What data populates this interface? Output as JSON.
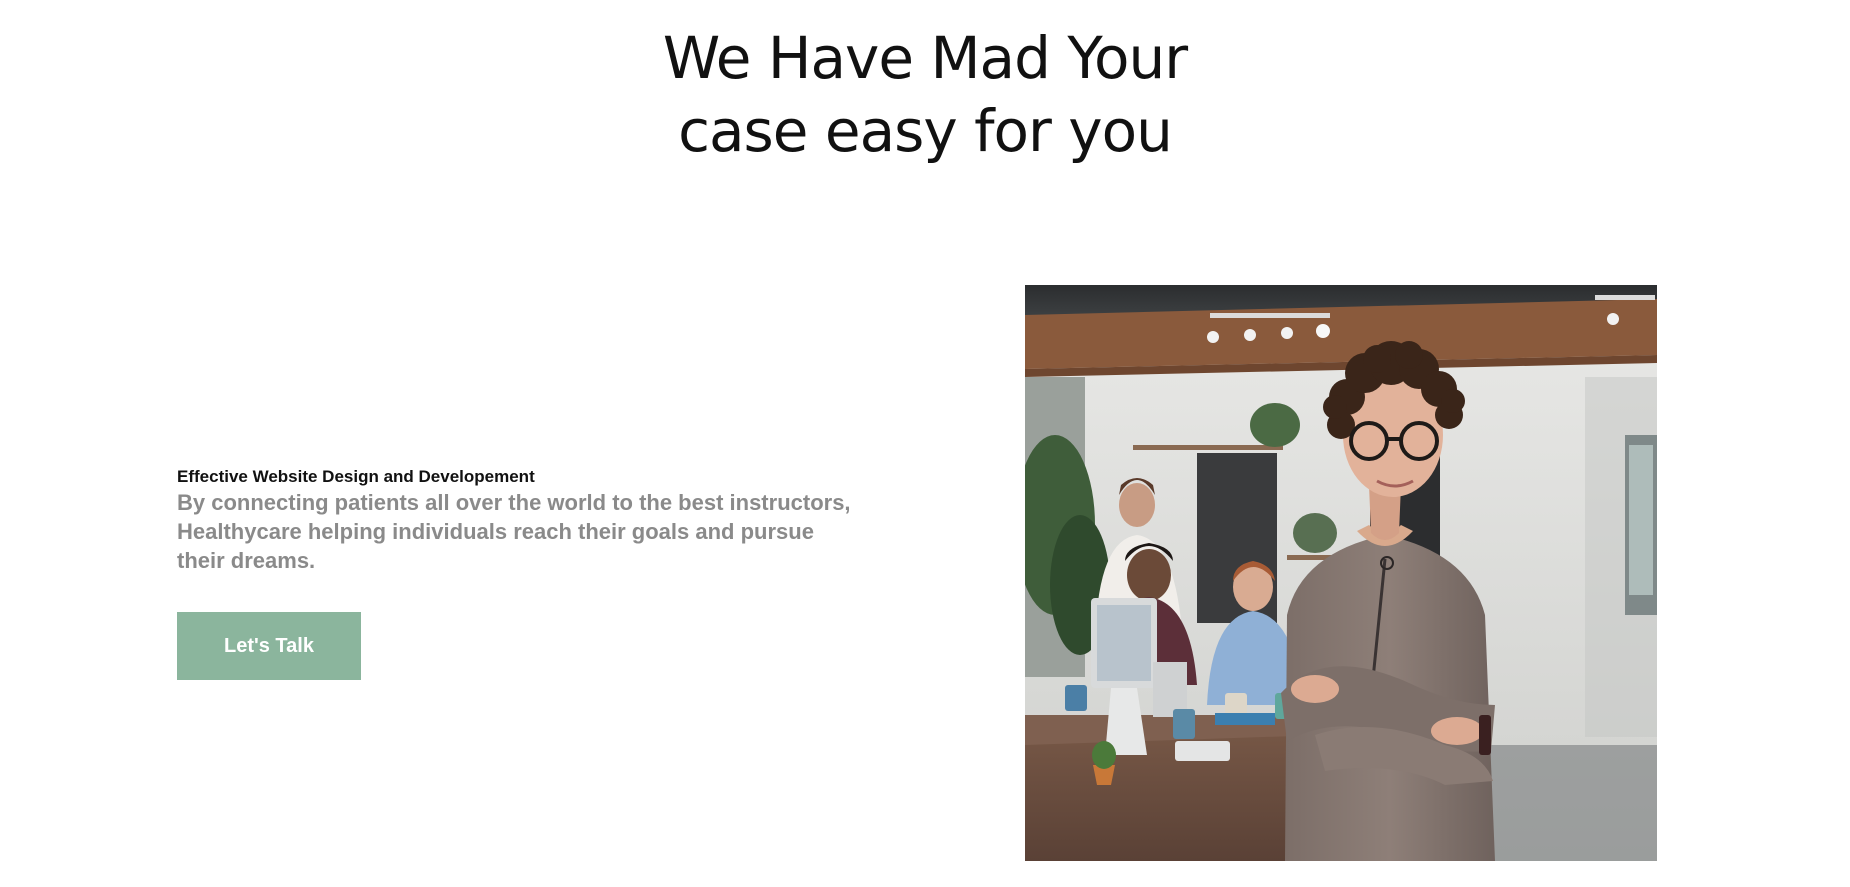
{
  "hero": {
    "title_line1": "We Have Mad Your",
    "title_line2": "case easy for you"
  },
  "intro": {
    "eyebrow": "Effective Website Design and Developement",
    "lead": "By connecting patients all over the world to the best instructors, Healthycare helping individuals reach their goals and pursue their dreams."
  },
  "cta": {
    "label": "Let's Talk"
  },
  "colors": {
    "accent": "#8bb59d",
    "lead_text": "#8a8a8a",
    "heading_text": "#111111"
  }
}
